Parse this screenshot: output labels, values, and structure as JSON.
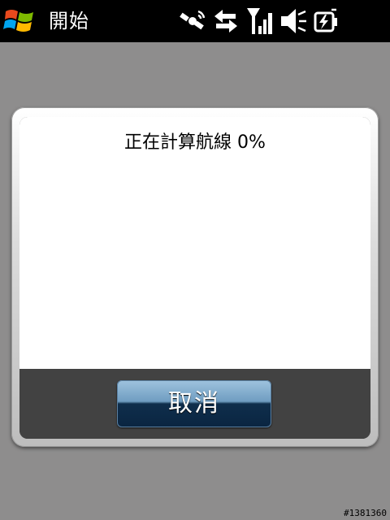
{
  "taskbar": {
    "start_label": "開始"
  },
  "icons": {
    "start": "windows-logo-icon",
    "gps": "satellite-icon",
    "data": "data-transfer-icon",
    "signal": "signal-strength-icon",
    "volume": "speaker-muted-icon",
    "battery": "battery-charging-icon"
  },
  "dialog": {
    "message": "正在計算航線 0%",
    "progress_percent": 0,
    "cancel_label": "取消"
  },
  "watermark": "#1381360",
  "colors": {
    "background": "#8e8d8d",
    "taskbar": "#000000",
    "footer": "#424242",
    "button_top": "#9fc3de",
    "button_bottom": "#0a2541"
  }
}
